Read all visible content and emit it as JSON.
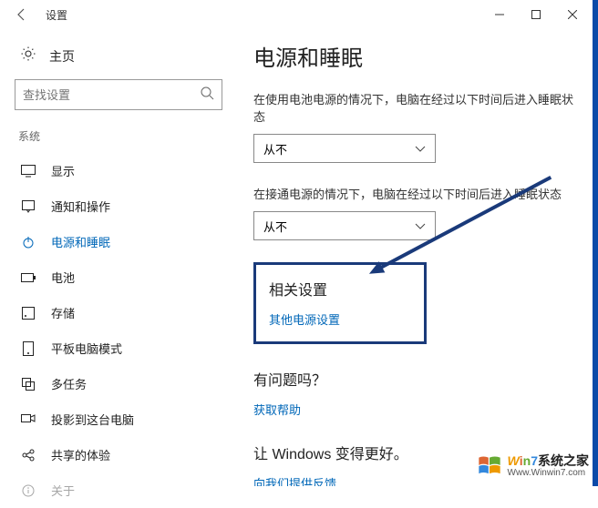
{
  "titlebar": {
    "title": "设置"
  },
  "sidebar": {
    "home": "主页",
    "search_placeholder": "查找设置",
    "group": "系统",
    "items": [
      {
        "label": "显示"
      },
      {
        "label": "通知和操作"
      },
      {
        "label": "电源和睡眠"
      },
      {
        "label": "电池"
      },
      {
        "label": "存储"
      },
      {
        "label": "平板电脑模式"
      },
      {
        "label": "多任务"
      },
      {
        "label": "投影到这台电脑"
      },
      {
        "label": "共享的体验"
      },
      {
        "label": "关于"
      }
    ]
  },
  "main": {
    "title": "电源和睡眠",
    "battery_desc": "在使用电池电源的情况下，电脑在经过以下时间后进入睡眠状态",
    "battery_value": "从不",
    "plugged_desc": "在接通电源的情况下，电脑在经过以下时间后进入睡眠状态",
    "plugged_value": "从不",
    "related_title": "相关设置",
    "related_link": "其他电源设置",
    "help_title": "有问题吗？",
    "help_link": "获取帮助",
    "feedback_title": "让 Windows 变得更好。",
    "feedback_link": "向我们提供反馈"
  },
  "watermark": {
    "brand": "Win7系统之家",
    "url": "Www.Winwin7.com"
  }
}
